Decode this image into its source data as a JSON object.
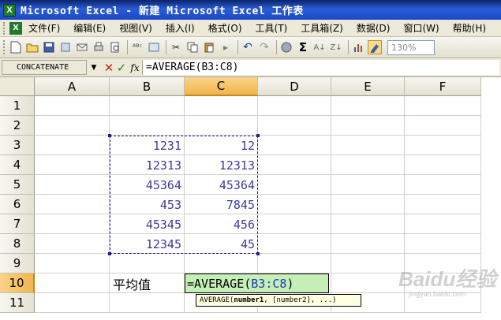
{
  "window": {
    "app_icon": "excel-icon",
    "title": "Microsoft Excel - 新建 Microsoft Excel 工作表"
  },
  "menu": {
    "items": [
      "文件(F)",
      "编辑(E)",
      "视图(V)",
      "插入(I)",
      "格式(O)",
      "工具(T)",
      "工具箱(Z)",
      "数据(D)",
      "窗口(W)",
      "帮助(H)"
    ]
  },
  "toolbar": {
    "sigma": "Σ",
    "zoom": "130%"
  },
  "formula_bar": {
    "name_box": "CONCATENATE",
    "cancel": "✕",
    "enter": "✓",
    "fx": "fx",
    "formula": "=AVERAGE(B3:C8)"
  },
  "sheet": {
    "columns": [
      "A",
      "B",
      "C",
      "D",
      "E",
      "F"
    ],
    "rows": [
      "1",
      "2",
      "3",
      "4",
      "5",
      "6",
      "7",
      "8",
      "9",
      "10",
      "11"
    ],
    "data": [
      {
        "b": "1231",
        "c": "12"
      },
      {
        "b": "12313",
        "c": "12313"
      },
      {
        "b": "45364",
        "c": "45364"
      },
      {
        "b": "453",
        "c": "7845"
      },
      {
        "b": "45345",
        "c": "456"
      },
      {
        "b": "12345",
        "c": "45"
      }
    ],
    "label_b10": "平均值",
    "edit_prefix": "=AVERAGE(",
    "edit_ref": "B3:C8",
    "edit_suffix": ")",
    "tooltip_fn": "AVERAGE(",
    "tooltip_arg1": "number1",
    "tooltip_rest": ", [number2], ...)"
  },
  "watermark": {
    "brand": "Baidu经验",
    "url": "jingyan.baidu.com"
  },
  "colors": {
    "selection_header": "#f1b54c",
    "edit_cell_bg": "#c6efb8",
    "number_text": "#3b3b9e"
  }
}
